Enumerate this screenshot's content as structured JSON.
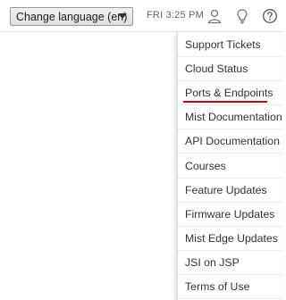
{
  "header": {
    "language_select": {
      "value": "Change language (en)"
    },
    "clock": "FRI 3:25 PM",
    "icons": [
      "user-icon",
      "lightbulb-icon",
      "help-icon"
    ]
  },
  "help_menu": {
    "items": [
      {
        "label": "Support Tickets"
      },
      {
        "label": "Cloud Status"
      },
      {
        "label": "Ports & Endpoints",
        "highlighted": true
      },
      {
        "label": "Mist Documentation"
      },
      {
        "label": "API Documentation"
      },
      {
        "label": "Courses"
      },
      {
        "label": "Feature Updates"
      },
      {
        "label": "Firmware Updates"
      },
      {
        "label": "Mist Edge Updates"
      },
      {
        "label": "JSI on JSP"
      },
      {
        "label": "Terms of Use"
      }
    ],
    "highlight_color": "#d0021b"
  }
}
